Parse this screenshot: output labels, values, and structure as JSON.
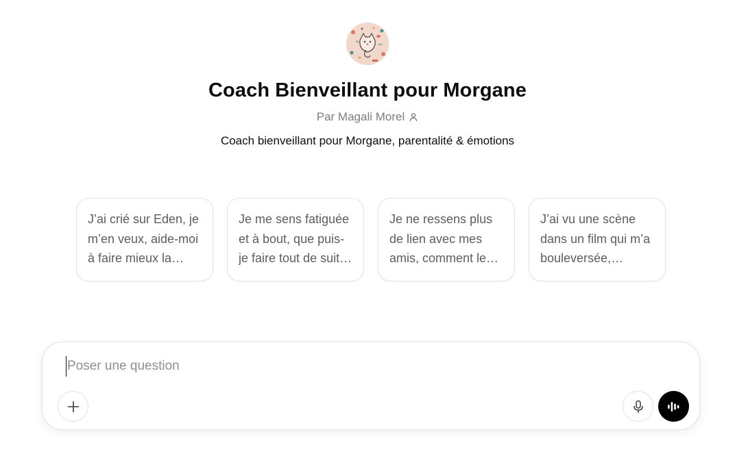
{
  "gpt": {
    "avatar_icon": "cat-illustration-avatar",
    "title": "Coach Bienveillant pour Morgane",
    "author": "Par Magali Morel",
    "author_icon": "person-icon",
    "description": "Coach bienveillant pour Morgane, parentalité & émotions"
  },
  "starters": [
    {
      "text": "J’ai crié sur Eden, je m’en veux, aide-moi à faire mieux la prochaine fois"
    },
    {
      "text": "Je me sens fatiguée et à bout, que puis-je faire tout de suite ?"
    },
    {
      "text": "Je ne ressens plus de lien avec mes amis, comment le retrouver ?"
    },
    {
      "text": "J’ai vu une scène dans un film qui m’a bouleversée, pourquoi ?"
    }
  ],
  "composer": {
    "placeholder": "Poser une question",
    "value": "",
    "add_icon": "plus-icon",
    "mic_icon": "microphone-icon",
    "voice_icon": "voice-waveform-icon"
  },
  "colors": {
    "voice_button_bg": "#000000",
    "muted_text": "#7d7d7d",
    "card_text": "#5d5d5d"
  }
}
